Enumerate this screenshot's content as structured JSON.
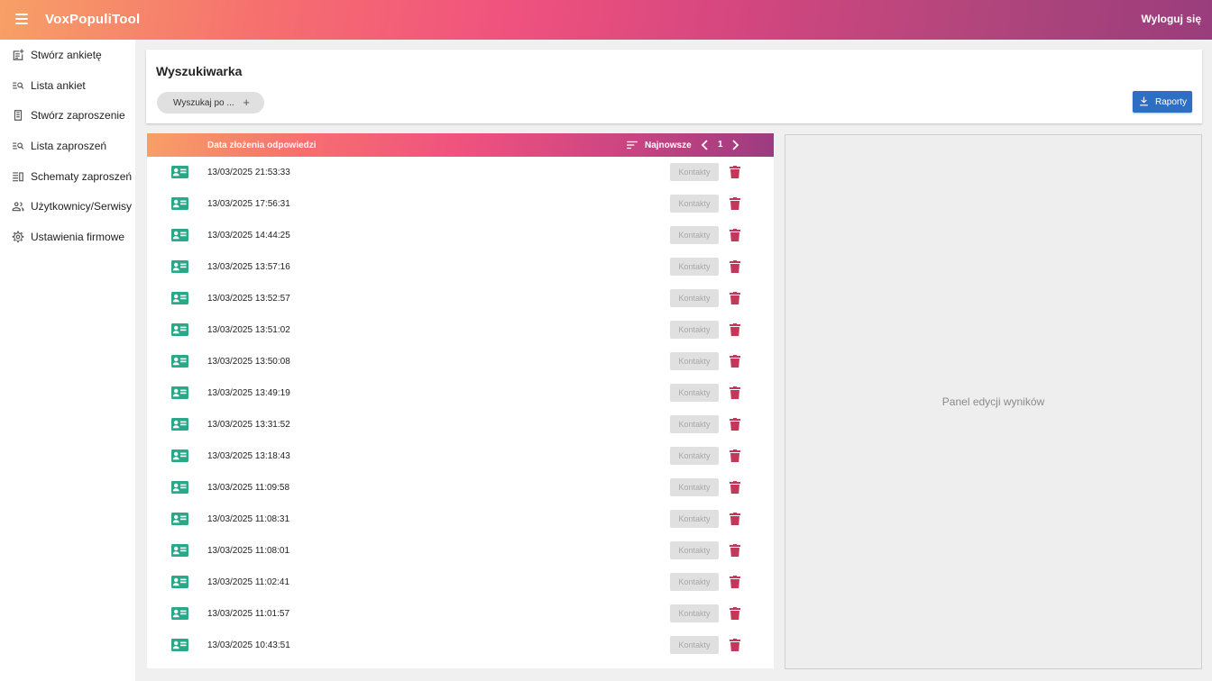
{
  "app": {
    "title": "VoxPopuliTool",
    "logout_label": "Wyloguj się"
  },
  "colors": {
    "accent_start": "#f7a066",
    "accent_mid": "#ef527f",
    "accent_end": "#9c3b80",
    "button_blue": "#2f6fc3",
    "icon_green": "#2aa88a",
    "trash_red": "#c2375a"
  },
  "sidebar": {
    "items": [
      {
        "label": "Stwórz ankietę",
        "icon": "new-survey-icon"
      },
      {
        "label": "Lista ankiet",
        "icon": "list-search-icon"
      },
      {
        "label": "Stwórz zaproszenie",
        "icon": "invitation-icon"
      },
      {
        "label": "Lista zaproszeń",
        "icon": "list-search-icon"
      },
      {
        "label": "Schematy zaproszeń",
        "icon": "schema-icon"
      },
      {
        "label": "Użytkownicy/Serwisy",
        "icon": "users-icon"
      },
      {
        "label": "Ustawienia firmowe",
        "icon": "gear-icon"
      }
    ]
  },
  "search": {
    "title": "Wyszukiwarka",
    "chip_label": "Wyszukaj po ...",
    "chip_add": "+",
    "report_label": "Raporty"
  },
  "list": {
    "column_header": "Data złożenia odpowiedzi",
    "sort_label": "Najnowsze",
    "page": "1",
    "contacts_label": "Kontakty",
    "rows": [
      "13/03/2025 21:53:33",
      "13/03/2025 17:56:31",
      "13/03/2025 14:44:25",
      "13/03/2025 13:57:16",
      "13/03/2025 13:52:57",
      "13/03/2025 13:51:02",
      "13/03/2025 13:50:08",
      "13/03/2025 13:49:19",
      "13/03/2025 13:31:52",
      "13/03/2025 13:18:43",
      "13/03/2025 11:09:58",
      "13/03/2025 11:08:31",
      "13/03/2025 11:08:01",
      "13/03/2025 11:02:41",
      "13/03/2025 11:01:57",
      "13/03/2025 10:43:51"
    ]
  },
  "edit_panel": {
    "placeholder": "Panel edycji wyników"
  }
}
